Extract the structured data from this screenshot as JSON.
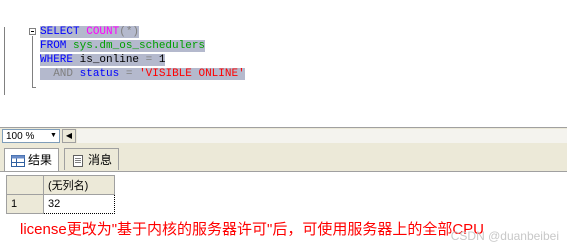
{
  "editor": {
    "lines": [
      {
        "k1": "SELECT",
        "f1": "COUNT",
        "g1": "(*)"
      },
      {
        "k1": "FROM",
        "o1": "sys.dm_os_schedulers"
      },
      {
        "k1": "WHERE",
        "t1": "is_online",
        "g1": "=",
        "t2": "1"
      },
      {
        "g0": "AND",
        "t1": "status",
        "g1": "=",
        "s1": "'VISIBLE ONLINE'"
      }
    ]
  },
  "zoom": {
    "value": "100 %"
  },
  "tabs": [
    {
      "label": "结果"
    },
    {
      "label": "消息"
    }
  ],
  "grid": {
    "column_header": "(无列名)",
    "rows": [
      {
        "num": "1",
        "value": "32"
      }
    ]
  },
  "annotation": "license更改为\"基于内核的服务器许可\"后，可使用服务器上的全部CPU",
  "watermark": "CSDN @duanbeibei"
}
